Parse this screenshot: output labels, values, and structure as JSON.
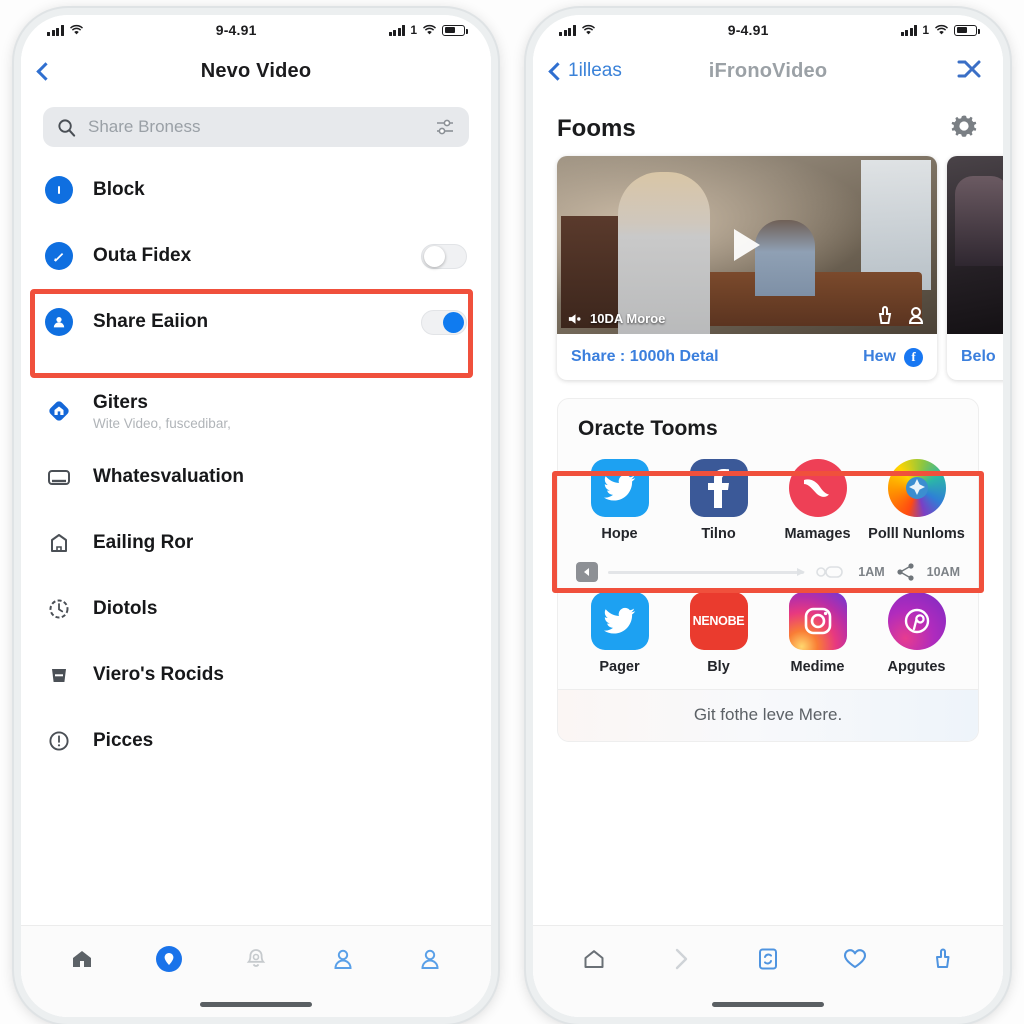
{
  "status_bar": {
    "time": "9-4.91",
    "left_signal_icon": "signal-bars-icon",
    "left_wifi_icon": "wifi-icon",
    "right_signal_icon": "signal-bars-icon",
    "right_label": "1",
    "right_wifi_icon": "wifi-icon",
    "battery_icon": "battery-icon"
  },
  "left_phone": {
    "nav": {
      "back_icon": "chevron-left-icon",
      "title": "Nevo Video"
    },
    "search": {
      "icon": "search-icon",
      "placeholder": "Share Broness",
      "trailing_icon": "filter-icon"
    },
    "items": [
      {
        "label": "Block",
        "sub": "",
        "icon": "info-circle-icon",
        "icon_style": "blue-circle",
        "toggle": "none"
      },
      {
        "label": "Outa Fidex",
        "sub": "",
        "icon": "edit-circle-icon",
        "icon_style": "blue-circle",
        "toggle": "off"
      },
      {
        "label": "Share Eaiion",
        "sub": "",
        "icon": "person-circle-icon",
        "icon_style": "blue-circle",
        "toggle": "on",
        "highlighted": true
      },
      {
        "label": "Giters",
        "sub": "Wite Video, fuscedibar,",
        "icon": "home-diamond-icon",
        "icon_style": "blue-shape",
        "toggle": "none"
      },
      {
        "label": "Whatesvaluation",
        "sub": "",
        "icon": "screen-icon",
        "icon_style": "outline",
        "toggle": "none"
      },
      {
        "label": "Eailing Ror",
        "sub": "",
        "icon": "house-outline-icon",
        "icon_style": "outline",
        "toggle": "none"
      },
      {
        "label": "Diotols",
        "sub": "",
        "icon": "clock-dashed-icon",
        "icon_style": "outline",
        "toggle": "none"
      },
      {
        "label": "Viero's Rocids",
        "sub": "",
        "icon": "trash-icon",
        "icon_style": "solid-gray",
        "toggle": "none"
      },
      {
        "label": "Picces",
        "sub": "",
        "icon": "alert-circle-icon",
        "icon_style": "outline",
        "toggle": "none"
      }
    ],
    "tabbar": [
      {
        "icon": "home-icon",
        "state": "inactive"
      },
      {
        "icon": "location-pin-icon",
        "state": "active"
      },
      {
        "icon": "bell-icon",
        "state": "inactive"
      },
      {
        "icon": "person-icon",
        "state": "blue"
      },
      {
        "icon": "person-icon",
        "state": "blue"
      }
    ]
  },
  "right_phone": {
    "nav": {
      "back_icon": "chevron-left-icon",
      "back_label": "1illeas",
      "title": "iFronoVideo",
      "right_icon": "shuffle-icon"
    },
    "section": {
      "title": "Fooms",
      "settings_icon": "gear-icon"
    },
    "video_cards": [
      {
        "duration_label": "10DA Moroe",
        "volume_icon": "volume-icon",
        "play_icon": "play-icon",
        "action_icons": [
          "like-icon",
          "comment-icon"
        ],
        "footer_left": "Share : 1000h Detal",
        "footer_right": "Hew",
        "footer_badge": "f"
      },
      {
        "duration_label": "",
        "volume_icon": "volume-icon",
        "footer_left": "Belo"
      }
    ],
    "panel": {
      "title": "Oracte Tooms",
      "apps_row_1": [
        {
          "name": "Hope",
          "icon": "twitter-icon"
        },
        {
          "name": "Tilno",
          "icon": "facebook-icon"
        },
        {
          "name": "Mamages",
          "icon": "pocket-icon"
        },
        {
          "name": "Polll Nunloms",
          "icon": "firefox-icon"
        }
      ],
      "slider": {
        "button_icon": "arrow-left-icon",
        "clip_icon": "clip-icon",
        "time_1": "1AM",
        "share_icon": "share-icon",
        "time_2": "10AM"
      },
      "apps_row_2": [
        {
          "name": "Pager",
          "icon": "twitter-icon"
        },
        {
          "name": "Bly",
          "icon": "nenobe-icon",
          "glyph_text": "NENOBE"
        },
        {
          "name": "Medime",
          "icon": "instagram-icon"
        },
        {
          "name": "Apgutes",
          "icon": "pinterest-icon"
        }
      ],
      "footer_text": "Git fothe leve Mere."
    },
    "tabbar": [
      {
        "icon": "home-outline-icon",
        "state": "inactive"
      },
      {
        "icon": "chevron-right-icon",
        "state": "faded"
      },
      {
        "icon": "copy-icon",
        "state": "blue"
      },
      {
        "icon": "heart-icon",
        "state": "blue"
      },
      {
        "icon": "thumbs-up-icon",
        "state": "blue"
      }
    ]
  },
  "colors": {
    "accent_blue": "#0f7bf0",
    "link_blue": "#3b7fdd",
    "highlight_red": "#f0503c",
    "text_dark": "#17181a",
    "text_muted": "#9aa0a6"
  }
}
